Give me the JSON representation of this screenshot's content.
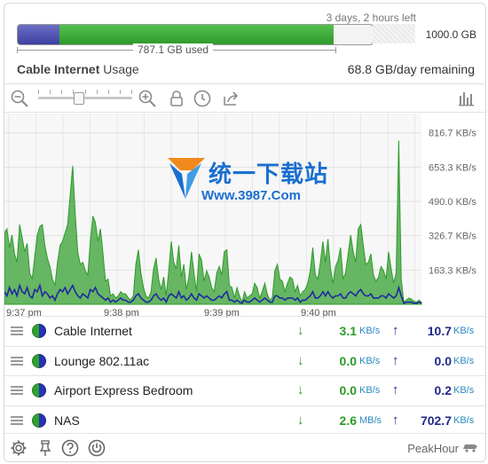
{
  "header": {
    "time_left": "3 days, 2 hours left",
    "cap": "1000.0 GB",
    "used": "787.1 GB used",
    "used_fraction": 0.787,
    "blue_fraction": 0.118,
    "title_bold": "Cable Internet",
    "title_rest": " Usage",
    "remaining": "68.8 GB/day remaining"
  },
  "toolbar": {
    "icons": [
      "zoom-out-icon",
      "zoom-slider",
      "zoom-in-icon",
      "lock-icon",
      "clock-icon",
      "share-icon",
      "bar-chart-icon"
    ]
  },
  "chart_data": {
    "type": "area",
    "y_unit": "KB/s",
    "ytick_labels": [
      "816.7 KB/s",
      "653.3 KB/s",
      "490.0 KB/s",
      "326.7 KB/s",
      "163.3 KB/s"
    ],
    "yticks": [
      816.7,
      653.3,
      490.0,
      326.7,
      163.3
    ],
    "ylim": [
      0,
      900
    ],
    "xtick_labels": [
      "9:37 pm",
      "9:38 pm",
      "9:39 pm",
      "9:40 pm"
    ],
    "series": [
      {
        "name": "Download",
        "color": "#2f9a2c",
        "values": [
          340,
          360,
          270,
          330,
          240,
          200,
          380,
          320,
          250,
          290,
          150,
          120,
          230,
          330,
          370,
          380,
          280,
          220,
          180,
          120,
          90,
          200,
          280,
          300,
          340,
          380,
          520,
          660,
          430,
          250,
          190,
          200,
          160,
          140,
          300,
          420,
          390,
          300,
          360,
          240,
          110,
          120,
          40,
          50,
          30,
          40,
          60,
          50,
          50,
          30,
          20,
          40,
          190,
          260,
          150,
          80,
          40,
          30,
          60,
          170,
          220,
          120,
          70,
          130,
          40,
          160,
          300,
          200,
          170,
          280,
          130,
          190,
          70,
          130,
          250,
          150,
          60,
          240,
          210,
          110,
          160,
          130,
          80,
          60,
          150,
          180,
          140,
          250,
          260,
          90,
          80,
          30,
          80,
          40,
          10,
          60,
          30,
          40,
          50,
          100,
          80,
          30,
          60,
          100,
          50,
          20,
          30,
          160,
          190,
          120,
          110,
          60,
          100,
          130,
          120,
          60,
          90,
          40,
          60,
          70,
          100,
          160,
          270,
          140,
          120,
          200,
          300,
          200,
          310,
          170,
          100,
          180,
          210,
          270,
          120,
          150,
          240,
          330,
          250,
          200,
          360,
          380,
          280,
          190,
          200,
          240,
          140,
          110,
          130,
          180,
          160,
          120,
          250,
          170,
          100,
          150,
          780,
          120,
          10,
          20,
          30,
          25,
          15,
          10,
          20,
          10
        ]
      },
      {
        "name": "Upload",
        "color": "#1f2aa0",
        "values": [
          60,
          40,
          80,
          50,
          70,
          40,
          90,
          60,
          50,
          80,
          40,
          30,
          70,
          60,
          90,
          40,
          60,
          50,
          30,
          40,
          20,
          50,
          70,
          60,
          80,
          50,
          70,
          90,
          60,
          40,
          30,
          50,
          40,
          30,
          70,
          60,
          80,
          50,
          40,
          30,
          20,
          30,
          10,
          20,
          10,
          20,
          30,
          20,
          20,
          10,
          10,
          20,
          40,
          50,
          30,
          20,
          10,
          10,
          20,
          40,
          50,
          30,
          20,
          30,
          10,
          40,
          50,
          40,
          30,
          60,
          30,
          40,
          20,
          30,
          50,
          30,
          20,
          50,
          40,
          30,
          40,
          30,
          20,
          20,
          30,
          40,
          30,
          50,
          60,
          20,
          20,
          10,
          20,
          10,
          5,
          20,
          10,
          10,
          20,
          30,
          20,
          10,
          20,
          30,
          20,
          10,
          10,
          40,
          40,
          30,
          30,
          20,
          30,
          30,
          30,
          20,
          30,
          10,
          20,
          20,
          30,
          40,
          60,
          30,
          30,
          40,
          60,
          40,
          60,
          40,
          30,
          40,
          40,
          50,
          30,
          30,
          50,
          60,
          50,
          40,
          60,
          70,
          50,
          40,
          40,
          50,
          30,
          30,
          30,
          40,
          40,
          30,
          50,
          40,
          30,
          40,
          80,
          40,
          5,
          10,
          10,
          10,
          5,
          5,
          10,
          5
        ]
      }
    ]
  },
  "devices": [
    {
      "name": "Cable Internet",
      "down": "3.1",
      "down_unit": "KB/s",
      "up": "10.7",
      "up_unit": "KB/s"
    },
    {
      "name": "Lounge 802.11ac",
      "down": "0.0",
      "down_unit": "KB/s",
      "up": "0.0",
      "up_unit": "KB/s"
    },
    {
      "name": "Airport Express Bedroom",
      "down": "0.0",
      "down_unit": "KB/s",
      "up": "0.2",
      "up_unit": "KB/s"
    },
    {
      "name": "NAS",
      "down": "2.6",
      "down_unit": "MB/s",
      "up": "702.7",
      "up_unit": "KB/s"
    }
  ],
  "arrows": {
    "down": "↓",
    "up": "↑"
  },
  "footer": {
    "brand": "PeakHour"
  },
  "watermark": {
    "line1": "统一下载站",
    "line2": "Www.3987.Com"
  },
  "colors": {
    "download": "#2f9a2c",
    "upload": "#1f2aa0",
    "accent_blue": "#2a8ac0"
  }
}
